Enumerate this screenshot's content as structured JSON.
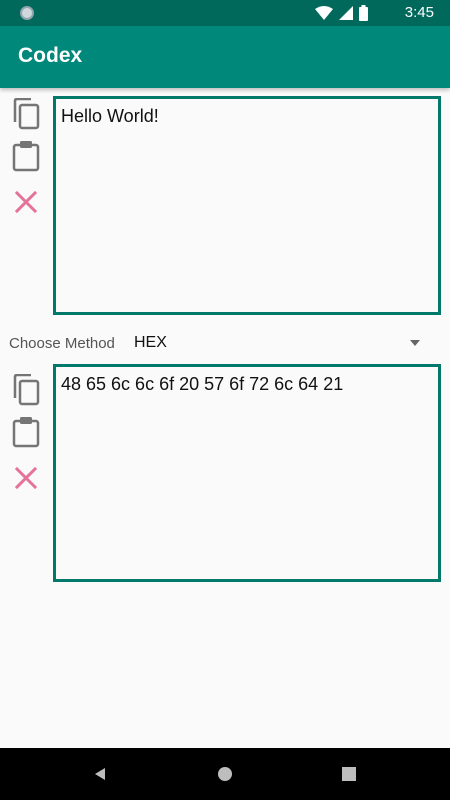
{
  "status_bar": {
    "time": "3:45",
    "icons": [
      "notification-dot-icon",
      "wifi-icon",
      "signal-icon",
      "battery-icon"
    ]
  },
  "app_bar": {
    "title": "Codex"
  },
  "input_panel": {
    "text": "Hello World!",
    "actions": [
      "copy-icon",
      "paste-icon",
      "clear-icon"
    ]
  },
  "method": {
    "label": "Choose Method",
    "selected": "HEX"
  },
  "output_panel": {
    "text": "48 65 6c 6c 6f 20 57 6f 72 6c 64 21",
    "actions": [
      "copy-icon",
      "paste-icon",
      "clear-icon"
    ]
  },
  "nav_bar": {
    "buttons": [
      "back-icon",
      "home-icon",
      "recents-icon"
    ]
  },
  "colors": {
    "status_bar": "#00695c",
    "app_bar": "#00897b",
    "accent_border": "#00796b",
    "icon_gray": "#757575",
    "clear_pink": "#e57399"
  }
}
